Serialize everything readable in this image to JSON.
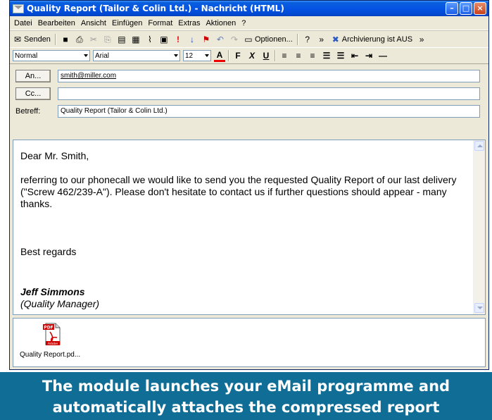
{
  "window": {
    "title": "Quality Report (Tailor & Colin Ltd.) - Nachricht (HTML)"
  },
  "menu": [
    "Datei",
    "Bearbeiten",
    "Ansicht",
    "Einfügen",
    "Format",
    "Extras",
    "Aktionen",
    "?"
  ],
  "toolbar": {
    "send_label": "Senden",
    "options_label": "Optionen...",
    "archive_label": "Archivierung ist AUS"
  },
  "format": {
    "style": "Normal",
    "font": "Arial",
    "size": "12"
  },
  "headers": {
    "to_label": "An...",
    "to_value": "smith@miller.com",
    "cc_label": "Cc...",
    "cc_value": "",
    "subject_label": "Betreff:",
    "subject_value": "Quality Report (Tailor & Colin Ltd.)"
  },
  "message": {
    "greeting": "Dear Mr. Smith,",
    "paragraph": "referring to our phonecall we would like to send you the requested Quality Report of our last delivery (\"Screw 462/239-A\"). Please don't hesitate to contact us if further questions should appear - many thanks.",
    "closing": "Best regards",
    "signature_name": "Jeff Simmons",
    "signature_role": "(Quality Manager)"
  },
  "attachment": {
    "filename": "Quality Report.pd...",
    "icon_text": "PDF",
    "icon_brand": "Adobe"
  },
  "banner": {
    "line1": "The module launches your eMail programme and",
    "line2": "automatically attaches the compressed report"
  },
  "colors": {
    "titlebar": "#0554e3",
    "banner": "#106d96",
    "window_bg": "#ece9d8"
  }
}
